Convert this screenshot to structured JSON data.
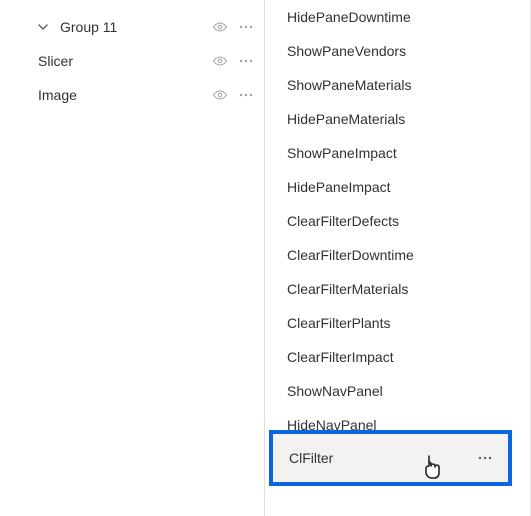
{
  "left": {
    "group_label": "Group 11",
    "items": [
      {
        "label": "Slicer"
      },
      {
        "label": "Image"
      }
    ]
  },
  "right": {
    "items": [
      "HidePaneDowntime",
      "ShowPaneVendors",
      "ShowPaneMaterials",
      "HidePaneMaterials",
      "ShowPaneImpact",
      "HidePaneImpact",
      "ClearFilterDefects",
      "ClearFilterDowntime",
      "ClearFilterMaterials",
      "ClearFilterPlants",
      "ClearFilterImpact",
      "ShowNavPanel",
      "HideNavPanel"
    ],
    "selected": "ClFilter"
  }
}
